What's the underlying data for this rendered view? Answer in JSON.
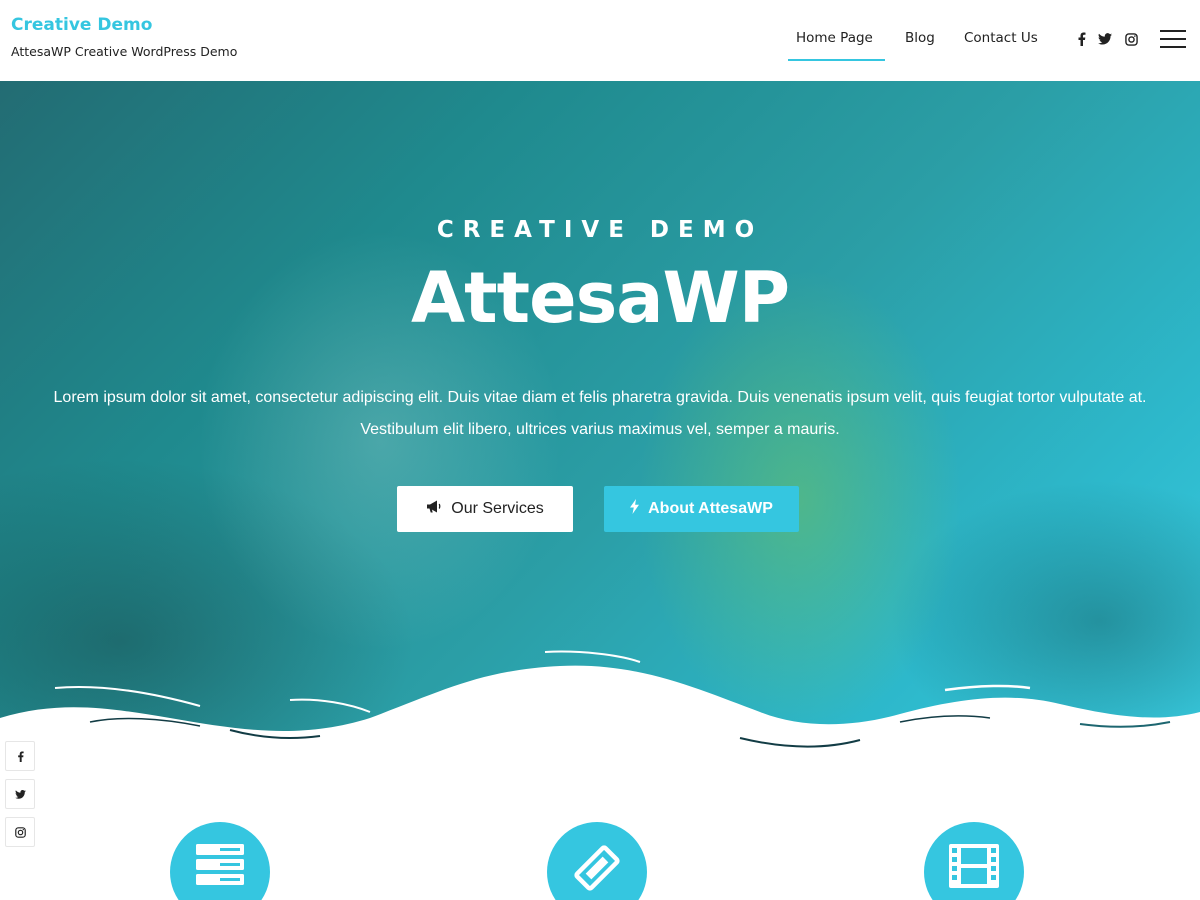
{
  "header": {
    "site_title": "Creative Demo",
    "site_tagline": "AttesaWP Creative WordPress Demo",
    "nav": [
      {
        "label": "Home Page",
        "active": true
      },
      {
        "label": "Blog",
        "active": false
      },
      {
        "label": "Contact Us",
        "active": false
      }
    ],
    "social_icons": [
      "facebook-icon",
      "twitter-icon",
      "instagram-icon"
    ],
    "menu_icon": "hamburger-menu-icon"
  },
  "hero": {
    "subtitle": "CREATIVE DEMO",
    "title": "AttesaWP",
    "text": "Lorem ipsum dolor sit amet, consectetur adipiscing elit. Duis vitae diam et felis pharetra gravida. Duis venenatis ipsum velit, quis feugiat tortor vulputate at. Vestibulum elit libero, ultrices varius maximus vel, semper a mauris.",
    "buttons": {
      "services": {
        "label": "Our Services",
        "icon": "megaphone-icon"
      },
      "about": {
        "label": "About AttesaWP",
        "icon": "bolt-icon"
      }
    }
  },
  "side_social": [
    "facebook-icon",
    "twitter-icon",
    "instagram-icon"
  ],
  "features": [
    {
      "icon": "server-icon"
    },
    {
      "icon": "ticket-icon"
    },
    {
      "icon": "film-icon"
    }
  ],
  "colors": {
    "accent": "#35c6e0",
    "text_dark": "#222222",
    "white": "#ffffff"
  }
}
